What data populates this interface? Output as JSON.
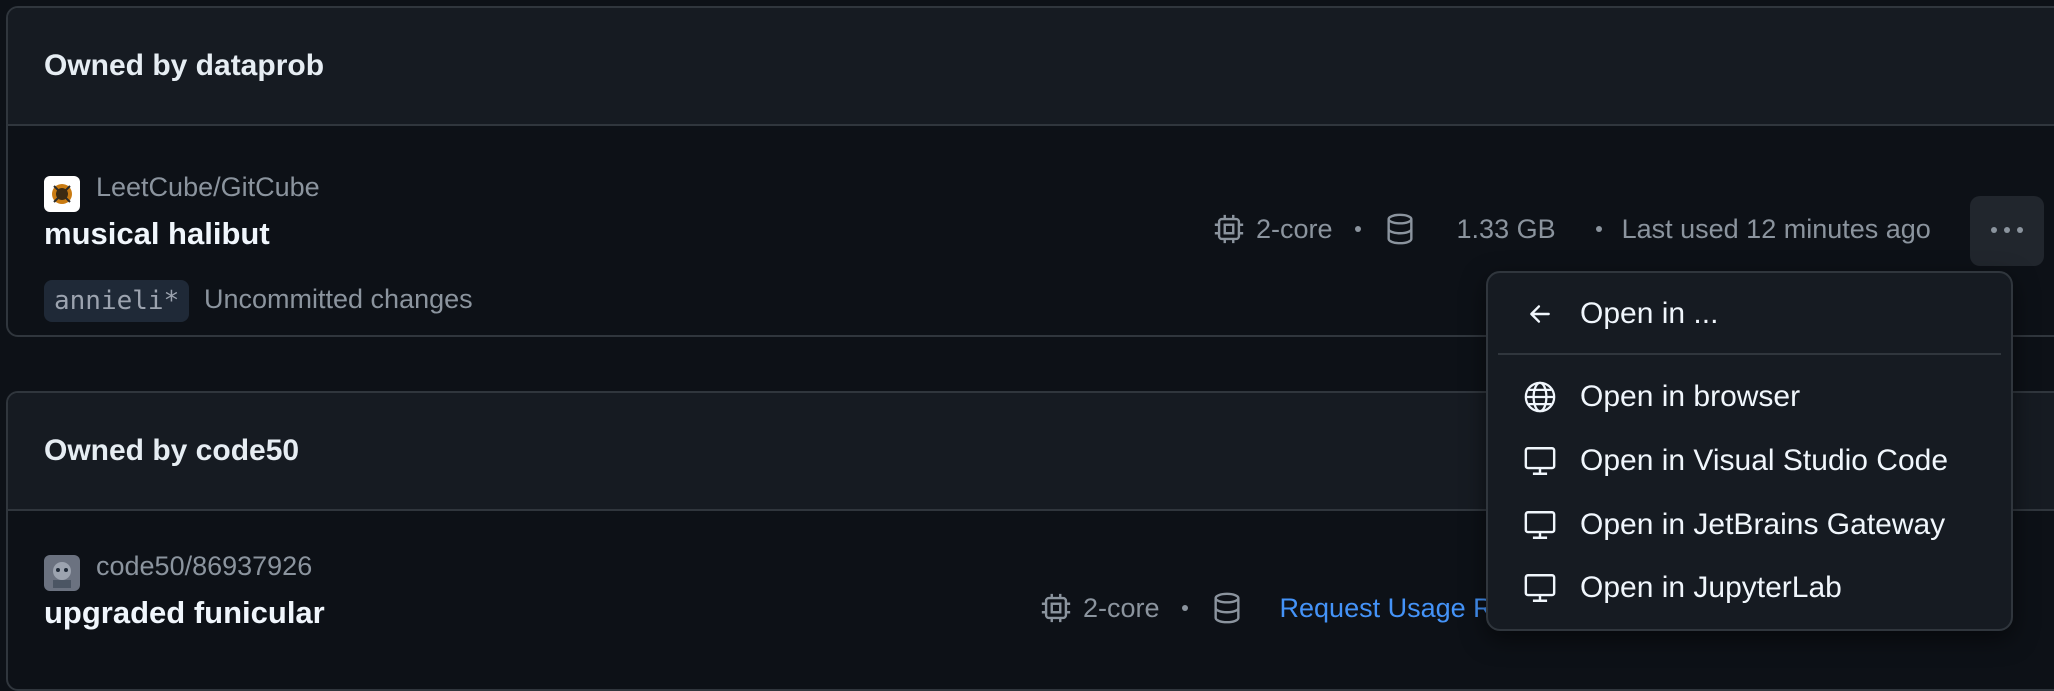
{
  "groups": [
    {
      "header": "Owned by dataprob",
      "codespace": {
        "repo": "LeetCube/GitCube",
        "name": "musical halibut",
        "branch": "annieli*",
        "branch_status": "Uncommitted changes",
        "machine": "2-core",
        "storage": "1.33 GB",
        "last_used": "Last used 12 minutes ago",
        "more_label": "···"
      }
    },
    {
      "header": "Owned by code50",
      "codespace": {
        "repo": "code50/86937926",
        "name": "upgraded funicular",
        "machine": "2-core",
        "usage_link": "Request Usage R"
      }
    }
  ],
  "menu": {
    "back_label": "Open in ...",
    "items": [
      {
        "label": "Open in browser",
        "icon": "globe-icon"
      },
      {
        "label": "Open in Visual Studio Code",
        "icon": "desktop-icon"
      },
      {
        "label": "Open in JetBrains Gateway",
        "icon": "desktop-icon"
      },
      {
        "label": "Open in JupyterLab",
        "icon": "desktop-icon"
      }
    ]
  },
  "colors": {
    "background": "#0d1117",
    "header_bg": "#161b22",
    "border": "#30363d",
    "link": "#4493f8"
  }
}
